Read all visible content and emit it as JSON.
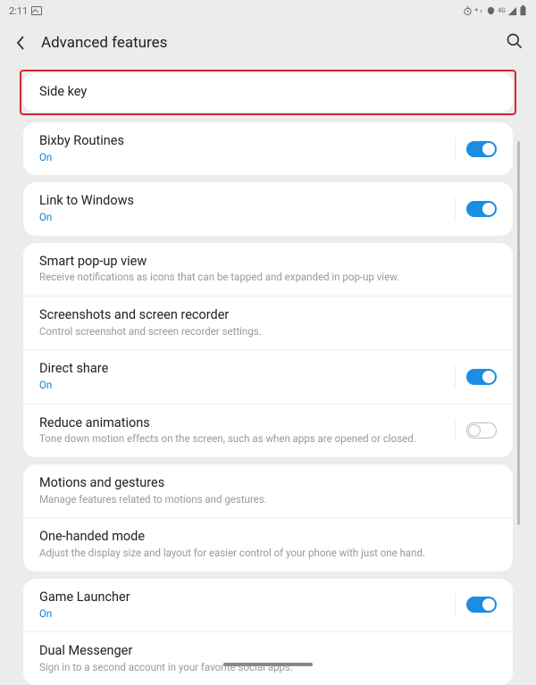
{
  "status": {
    "time": "2:11"
  },
  "header": {
    "title": "Advanced features"
  },
  "groups": [
    {
      "highlight": true,
      "rows": [
        {
          "title": "Side key",
          "sub": "",
          "toggle": null,
          "interact": true
        }
      ]
    },
    {
      "rows": [
        {
          "title": "Bixby Routines",
          "sub": "On",
          "subOn": true,
          "toggle": true
        }
      ]
    },
    {
      "rows": [
        {
          "title": "Link to Windows",
          "sub": "On",
          "subOn": true,
          "toggle": true
        }
      ]
    },
    {
      "rows": [
        {
          "title": "Smart pop-up view",
          "sub": "Receive notifications as icons that can be tapped and expanded in pop-up view.",
          "toggle": null
        },
        {
          "title": "Screenshots and screen recorder",
          "sub": "Control screenshot and screen recorder settings.",
          "toggle": null
        },
        {
          "title": "Direct share",
          "sub": "On",
          "subOn": true,
          "toggle": true
        },
        {
          "title": "Reduce animations",
          "sub": "Tone down motion effects on the screen, such as when apps are opened or closed.",
          "toggle": false
        }
      ]
    },
    {
      "rows": [
        {
          "title": "Motions and gestures",
          "sub": "Manage features related to motions and gestures.",
          "toggle": null
        },
        {
          "title": "One-handed mode",
          "sub": "Adjust the display size and layout for easier control of your phone with just one hand.",
          "toggle": null
        }
      ]
    },
    {
      "rows": [
        {
          "title": "Game Launcher",
          "sub": "On",
          "subOn": true,
          "toggle": true
        },
        {
          "title": "Dual Messenger",
          "sub": "Sign in to a second account in your favorite social apps.",
          "toggle": null
        }
      ]
    }
  ]
}
